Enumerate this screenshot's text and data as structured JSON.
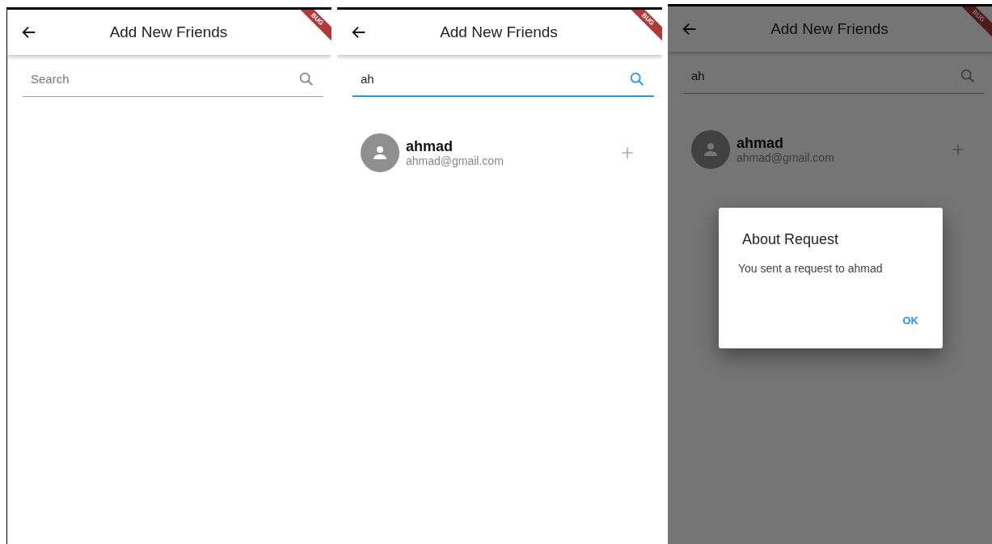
{
  "screens": [
    {
      "app_bar": {
        "title": "Add New Friends"
      },
      "debug_ribbon": "BUG",
      "search": {
        "placeholder": "Search",
        "focused": false
      }
    },
    {
      "app_bar": {
        "title": "Add New Friends"
      },
      "debug_ribbon": "BUG",
      "search": {
        "value": "ah",
        "focused": true
      },
      "results": [
        {
          "name": "ahmad",
          "email": "ahmad@gmail.com"
        }
      ]
    },
    {
      "app_bar": {
        "title": "Add New Friends"
      },
      "debug_ribbon": "BUG",
      "search": {
        "value": "ah",
        "focused": false
      },
      "results": [
        {
          "name": "ahmad",
          "email": "ahmad@gmail.com"
        }
      ],
      "dimmed": true,
      "dialog": {
        "title": "About Request",
        "message": "You sent a request to ahmad",
        "button": "OK"
      }
    }
  ]
}
